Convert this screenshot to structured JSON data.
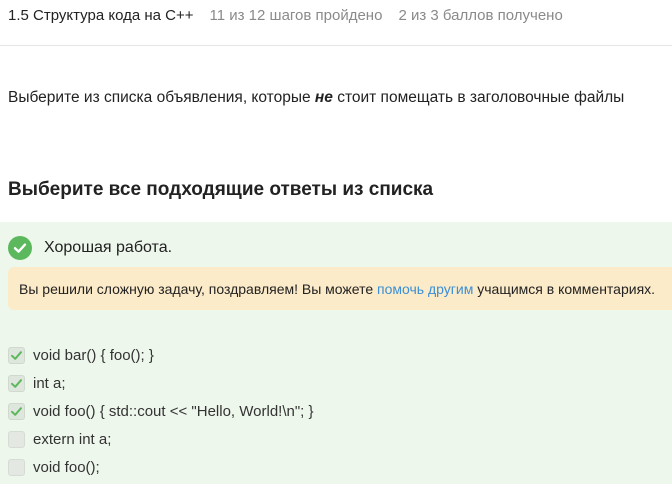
{
  "header": {
    "lesson_title": "1.5 Структура кода на C++",
    "steps_progress": "11 из 12 шагов пройдено",
    "score_progress": "2 из 3 баллов  получено"
  },
  "question": {
    "text_before": "Выберите из списка объявления, которые ",
    "emphasis": "не",
    "text_after": " стоит помещать в заголовочные файлы"
  },
  "prompt": {
    "heading": "Выберите все подходящие ответы из списка"
  },
  "result": {
    "status_icon": "check-circle-icon",
    "message": "Хорошая работа."
  },
  "hint": {
    "text_before": "Вы решили сложную задачу, поздравляем! Вы можете ",
    "link_text": "помочь другим",
    "text_after": " учащимся в комментариях."
  },
  "options": [
    {
      "label": "void bar() { foo(); }",
      "checked": true
    },
    {
      "label": "int a;",
      "checked": true
    },
    {
      "label": "void foo() { std::cout << \"Hello, World!\\n\"; }",
      "checked": true
    },
    {
      "label": "extern int a;",
      "checked": false
    },
    {
      "label": "void foo();",
      "checked": false
    }
  ],
  "colors": {
    "success": "#5cb85c",
    "panel_bg": "#eef7ec",
    "hint_bg": "#fcebc9",
    "link": "#3a8fd6"
  }
}
